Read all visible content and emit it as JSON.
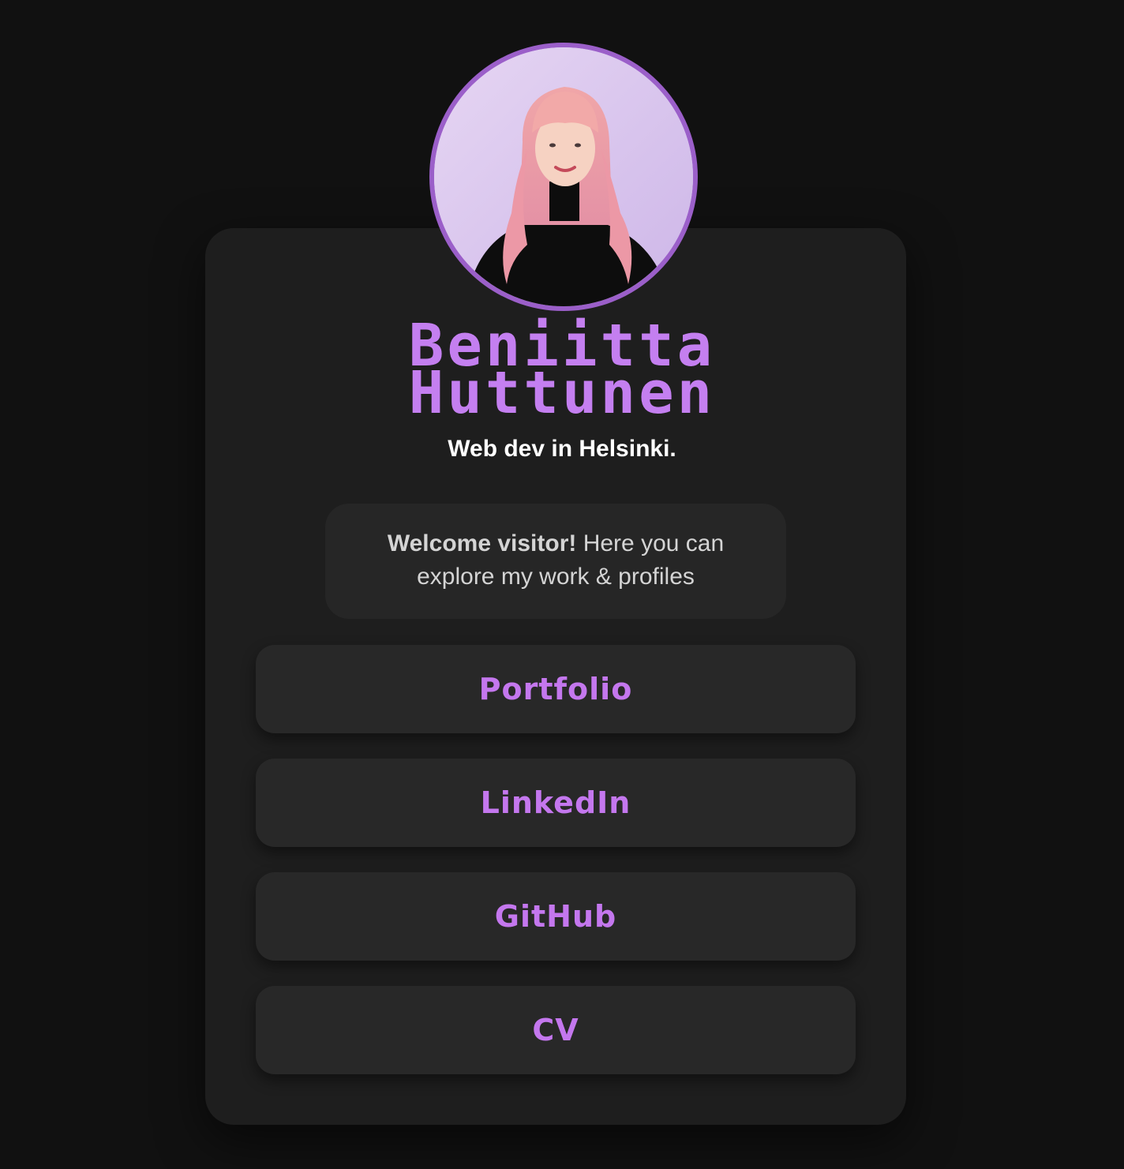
{
  "profile": {
    "first_name": "Beniitta",
    "last_name": "Huttunen",
    "tagline": "Web dev in Helsinki.",
    "avatar_icon": "profile-photo"
  },
  "welcome": {
    "bold": "Welcome visitor!",
    "text": " Here you can explore my work & profiles"
  },
  "links": [
    {
      "label": "Portfolio"
    },
    {
      "label": "LinkedIn"
    },
    {
      "label": "GitHub"
    },
    {
      "label": "CV"
    }
  ],
  "colors": {
    "background": "#111111",
    "card": "#1e1e1e",
    "accent": "#c47ff0",
    "avatar_border": "#9b5fc9"
  }
}
